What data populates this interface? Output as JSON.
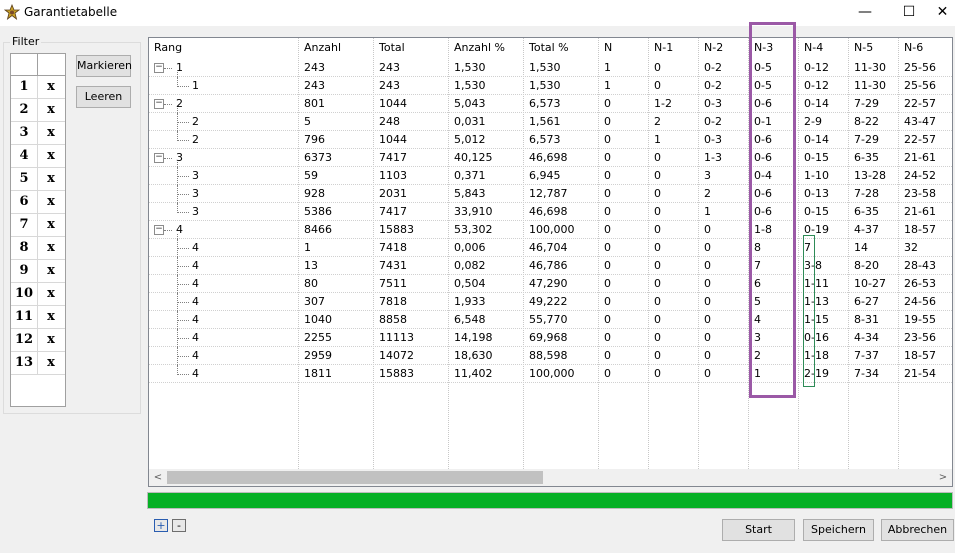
{
  "window": {
    "title": "Garantietabelle",
    "minimize_glyph": "—",
    "maximize_glyph": "☐",
    "close_glyph": "✕"
  },
  "filter": {
    "label": "Filter",
    "rows": [
      {
        "num": "1",
        "val": "x"
      },
      {
        "num": "2",
        "val": "x"
      },
      {
        "num": "3",
        "val": "x"
      },
      {
        "num": "4",
        "val": "x"
      },
      {
        "num": "5",
        "val": "x"
      },
      {
        "num": "6",
        "val": "x"
      },
      {
        "num": "7",
        "val": "x"
      },
      {
        "num": "8",
        "val": "x"
      },
      {
        "num": "9",
        "val": "x"
      },
      {
        "num": "10",
        "val": "x"
      },
      {
        "num": "11",
        "val": "x"
      },
      {
        "num": "12",
        "val": "x"
      },
      {
        "num": "13",
        "val": "x"
      }
    ],
    "markieren_label": "Markieren",
    "leeren_label": "Leeren"
  },
  "table": {
    "columns": [
      "Rang",
      "Anzahl",
      "Total",
      "Anzahl %",
      "Total %",
      "N",
      "N-1",
      "N-2",
      "N-3",
      "N-4",
      "N-5",
      "N-6"
    ],
    "rows": [
      {
        "level": 0,
        "expand": "−",
        "cells": [
          "1",
          "243",
          "243",
          "1,530",
          "1,530",
          "1",
          "0",
          "0-2",
          "0-5",
          "0-12",
          "11-30",
          "25-56"
        ]
      },
      {
        "level": 1,
        "cells": [
          "1",
          "243",
          "243",
          "1,530",
          "1,530",
          "1",
          "0",
          "0-2",
          "0-5",
          "0-12",
          "11-30",
          "25-56"
        ]
      },
      {
        "level": 0,
        "expand": "−",
        "cells": [
          "2",
          "801",
          "1044",
          "5,043",
          "6,573",
          "0",
          "1-2",
          "0-3",
          "0-6",
          "0-14",
          "7-29",
          "22-57"
        ]
      },
      {
        "level": 1,
        "cells": [
          "2",
          "5",
          "248",
          "0,031",
          "1,561",
          "0",
          "2",
          "0-2",
          "0-1",
          "2-9",
          "8-22",
          "43-47"
        ]
      },
      {
        "level": 1,
        "cells": [
          "2",
          "796",
          "1044",
          "5,012",
          "6,573",
          "0",
          "1",
          "0-3",
          "0-6",
          "0-14",
          "7-29",
          "22-57"
        ]
      },
      {
        "level": 0,
        "expand": "−",
        "cells": [
          "3",
          "6373",
          "7417",
          "40,125",
          "46,698",
          "0",
          "0",
          "1-3",
          "0-6",
          "0-15",
          "6-35",
          "21-61"
        ]
      },
      {
        "level": 1,
        "cells": [
          "3",
          "59",
          "1103",
          "0,371",
          "6,945",
          "0",
          "0",
          "3",
          "0-4",
          "1-10",
          "13-28",
          "24-52"
        ]
      },
      {
        "level": 1,
        "cells": [
          "3",
          "928",
          "2031",
          "5,843",
          "12,787",
          "0",
          "0",
          "2",
          "0-6",
          "0-13",
          "7-28",
          "23-58"
        ]
      },
      {
        "level": 1,
        "cells": [
          "3",
          "5386",
          "7417",
          "33,910",
          "46,698",
          "0",
          "0",
          "1",
          "0-6",
          "0-15",
          "6-35",
          "21-61"
        ]
      },
      {
        "level": 0,
        "expand": "−",
        "cells": [
          "4",
          "8466",
          "15883",
          "53,302",
          "100,000",
          "0",
          "0",
          "0",
          "1-8",
          "0-19",
          "4-37",
          "18-57"
        ]
      },
      {
        "level": 1,
        "cells": [
          "4",
          "1",
          "7418",
          "0,006",
          "46,704",
          "0",
          "0",
          "0",
          "8",
          "7",
          "14",
          "32"
        ]
      },
      {
        "level": 1,
        "cells": [
          "4",
          "13",
          "7431",
          "0,082",
          "46,786",
          "0",
          "0",
          "0",
          "7",
          "3-8",
          "8-20",
          "28-43"
        ]
      },
      {
        "level": 1,
        "cells": [
          "4",
          "80",
          "7511",
          "0,504",
          "47,290",
          "0",
          "0",
          "0",
          "6",
          "1-11",
          "10-27",
          "26-53"
        ]
      },
      {
        "level": 1,
        "cells": [
          "4",
          "307",
          "7818",
          "1,933",
          "49,222",
          "0",
          "0",
          "0",
          "5",
          "1-13",
          "6-27",
          "24-56"
        ]
      },
      {
        "level": 1,
        "cells": [
          "4",
          "1040",
          "8858",
          "6,548",
          "55,770",
          "0",
          "0",
          "0",
          "4",
          "1-15",
          "8-31",
          "19-55"
        ]
      },
      {
        "level": 1,
        "cells": [
          "4",
          "2255",
          "11113",
          "14,198",
          "69,968",
          "0",
          "0",
          "0",
          "3",
          "0-16",
          "4-34",
          "23-56"
        ]
      },
      {
        "level": 1,
        "cells": [
          "4",
          "2959",
          "14072",
          "18,630",
          "88,598",
          "0",
          "0",
          "0",
          "2",
          "1-18",
          "7-37",
          "18-57"
        ]
      },
      {
        "level": 1,
        "cells": [
          "4",
          "1811",
          "15883",
          "11,402",
          "100,000",
          "0",
          "0",
          "0",
          "1",
          "2-19",
          "7-34",
          "21-54"
        ]
      }
    ],
    "scroll_left_glyph": "<",
    "scroll_right_glyph": ">"
  },
  "progress": {
    "value": 1.0,
    "color": "#06b025"
  },
  "highlight_color": "#9b59a6",
  "footer": {
    "expand_glyph": "+",
    "collapse_glyph": "-",
    "start_label": "Start",
    "save_label": "Speichern",
    "cancel_label": "Abbrechen"
  }
}
